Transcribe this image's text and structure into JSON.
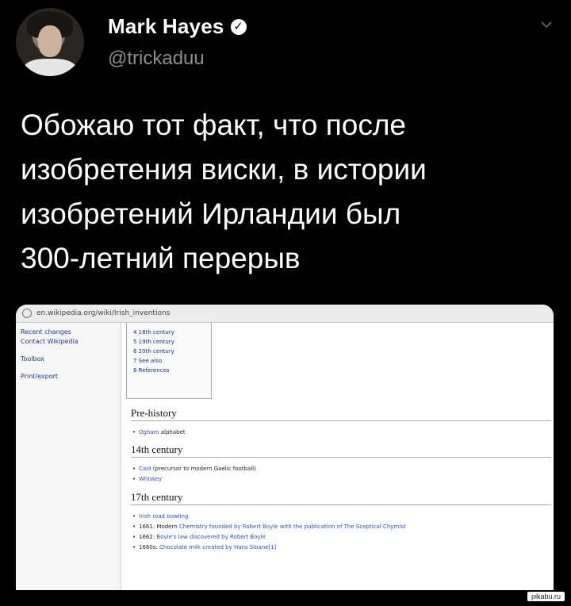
{
  "author": {
    "name": "Mark Hayes",
    "handle": "@trickaduu"
  },
  "tweet": {
    "text": "Обожаю тот факт, что после\nизобретения виски, в истории\nизобретений Ирландии был\n300-летний перерыв"
  },
  "screenshot": {
    "url": "en.wikipedia.org/wiki/Irish_inventions",
    "sidebar": [
      "Recent changes",
      "Contact Wikipedia",
      "Toolbox",
      "Print/export"
    ],
    "toc": [
      "4 18th century",
      "5 19th century",
      "6 20th century",
      "7 See also",
      "8 References"
    ],
    "sections": [
      {
        "title": "Pre-history",
        "items": [
          [
            "Ogham",
            " alphabet"
          ]
        ]
      },
      {
        "title": "14th century",
        "items": [
          [
            "Caid",
            " (precursor to modern Gaelic football)"
          ],
          [
            "Whiskey",
            ""
          ]
        ]
      },
      {
        "title": "17th century",
        "items": [
          [
            "Irish road bowling",
            ""
          ],
          [
            "1661: Modern ",
            "Chemistry founded by Robert Boyle with the publication of The Sceptical Chymist"
          ],
          [
            "1662: ",
            "Boyle's law discovered by Robert Boyle"
          ],
          [
            "1680s: ",
            "Chocolate milk created by Hans Sloane[1]"
          ]
        ]
      }
    ]
  },
  "watermark": "pikabu.ru",
  "colors": {
    "background": "#000000",
    "handle": "#8e8e8e",
    "link": "#3050b0"
  },
  "icons": [
    "verified-badge-icon",
    "chevron-down-icon",
    "globe-icon"
  ]
}
